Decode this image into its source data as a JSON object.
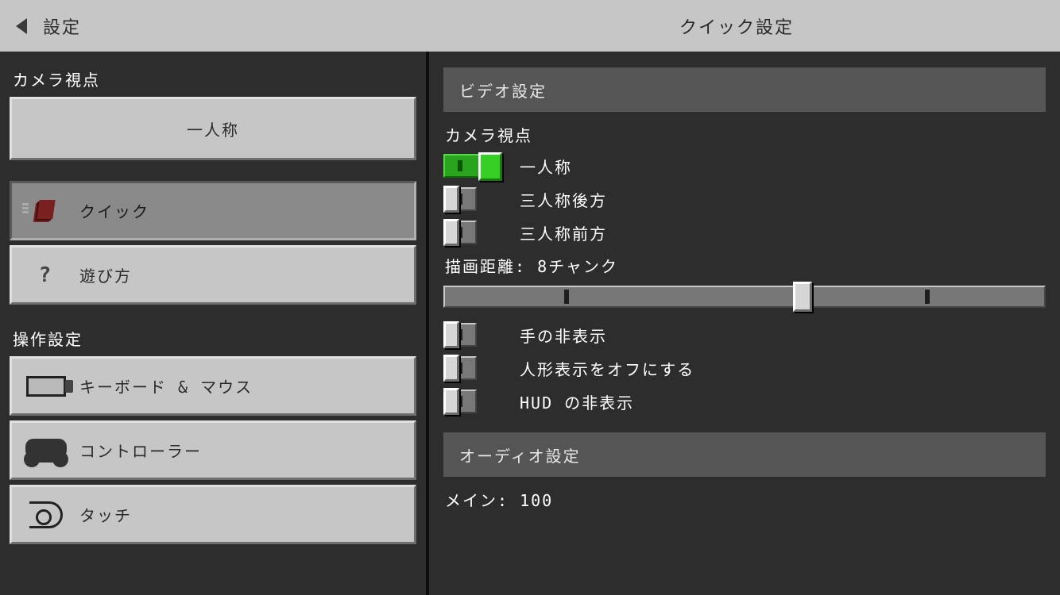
{
  "header": {
    "title": "設定",
    "page_title": "クイック設定"
  },
  "sidebar": {
    "camera_section": "カメラ視点",
    "camera_button": "一人称",
    "items": [
      {
        "label": "クイック",
        "selected": true,
        "icon": "quick-icon"
      },
      {
        "label": "遊び方",
        "selected": false,
        "icon": "question-icon"
      }
    ],
    "controls_section": "操作設定",
    "controls": [
      {
        "label": "キーボード & マウス",
        "icon": "keyboard-icon"
      },
      {
        "label": "コントローラー",
        "icon": "controller-icon"
      },
      {
        "label": "タッチ",
        "icon": "touch-icon"
      }
    ]
  },
  "main": {
    "video_header": "ビデオ設定",
    "camera_label": "カメラ視点",
    "camera_options": [
      {
        "label": "一人称",
        "on": true
      },
      {
        "label": "三人称後方",
        "on": false
      },
      {
        "label": "三人称前方",
        "on": false
      }
    ],
    "render_label": "描画距離: 8チャンク",
    "toggles": [
      {
        "label": "手の非表示",
        "on": false
      },
      {
        "label": "人形表示をオフにする",
        "on": false
      },
      {
        "label": "HUD の非表示",
        "on": false
      }
    ],
    "audio_header": "オーディオ設定",
    "main_volume_label": "メイン: 100"
  }
}
